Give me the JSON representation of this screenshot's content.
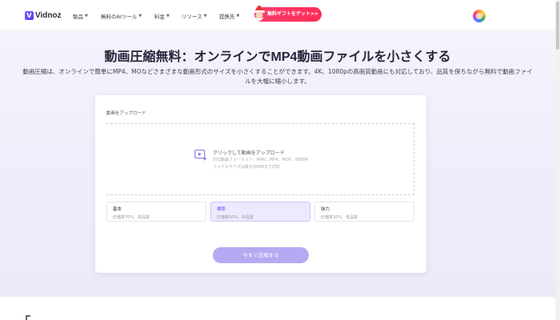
{
  "nav": {
    "logo_text": "Vidnoz",
    "items": [
      {
        "label": "製品"
      },
      {
        "label": "無料のAIツール"
      },
      {
        "label": "料金"
      },
      {
        "label": "リソース"
      },
      {
        "label": "提携先"
      }
    ],
    "gift_label": "無料ギフトをゲット>>"
  },
  "hero": {
    "title": "動画圧縮無料：オンラインでMP4動画ファイルを小さくする",
    "description": "動画圧縮は、オンラインで簡単にMP4、MOなどさまざまな動画形式のサイズを小さくすることができます。4K、1080pの高画質動画にも対応しており、品質を保ちながら無料で動画ファイルを大幅に縮小します。"
  },
  "upload": {
    "label": "動画をアップロード",
    "click_text": "クリックして動画をアップロード",
    "formats": "対応動画フォーマット：M4V、MP4、MOV、WEBM",
    "size_limit": "ファイルサイズは最大50MBまで対応"
  },
  "options": [
    {
      "name": "基本",
      "detail": "圧縮率70%、高品質"
    },
    {
      "name": "標準",
      "detail": "圧縮率50%、中品質"
    },
    {
      "name": "強力",
      "detail": "圧縮率30%、低品質"
    }
  ],
  "compress_button": "今すぐ圧縮する",
  "colors": {
    "accent": "#6b4ff0",
    "button": "#b6a9f3",
    "gift": "#ff2d55",
    "hero_bg": "#ece9fa"
  }
}
